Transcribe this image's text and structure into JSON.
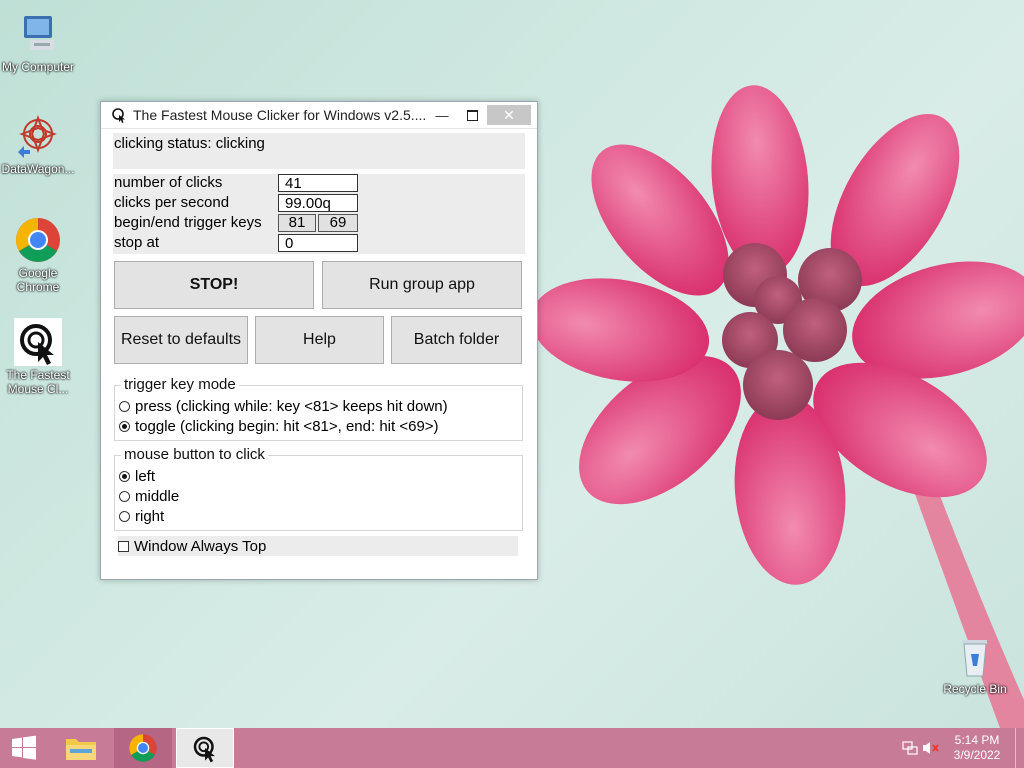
{
  "desktop": {
    "icons": [
      {
        "label": "My Computer",
        "icon": "computer-icon"
      },
      {
        "label": "DataWagon...",
        "icon": "datawagon-icon"
      },
      {
        "label": "Google Chrome",
        "icon": "chrome-icon"
      },
      {
        "label": "The Fastest Mouse Cl...",
        "icon": "mouse-clicker-icon"
      },
      {
        "label": "Recycle Bin",
        "icon": "recycle-bin-icon"
      }
    ]
  },
  "window": {
    "title": "The Fastest Mouse Clicker for Windows v2.5....",
    "status": "clicking status: clicking",
    "params": {
      "clicks_label": "number of clicks",
      "clicks_value": "41",
      "cps_label": "clicks per second",
      "cps_value": "99.00q",
      "trigger_label": "begin/end trigger keys",
      "trigger_begin": "81",
      "trigger_end": "69",
      "stop_label": "stop at",
      "stop_value": "0"
    },
    "buttons": {
      "stop": "STOP!",
      "run_group": "Run group app",
      "reset": "Reset to defaults",
      "help": "Help",
      "batch": "Batch folder"
    },
    "trigger_mode": {
      "label": "trigger key mode",
      "press": "press (clicking while: key <81> keeps hit down)",
      "toggle": "toggle (clicking begin: hit <81>, end: hit <69>)",
      "selected": "toggle"
    },
    "mouse_button": {
      "label": "mouse button to click",
      "left": "left",
      "middle": "middle",
      "right": "right",
      "selected": "left"
    },
    "always_top": {
      "label": "Window Always Top",
      "checked": false
    }
  },
  "taskbar": {
    "time": "5:14 PM",
    "date": "3/9/2022"
  },
  "colors": {
    "taskbar": "#c77b97",
    "flower": "#e0457e"
  }
}
